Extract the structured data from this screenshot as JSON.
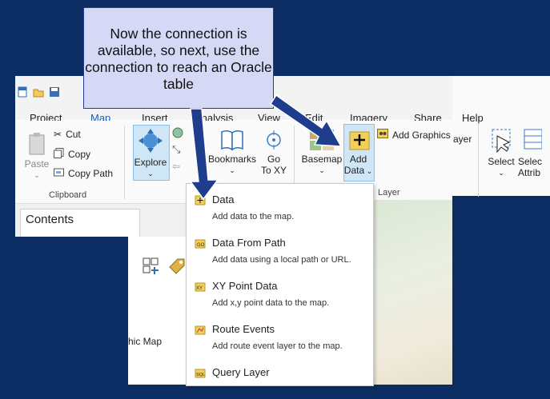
{
  "quick_access": [
    "new-project-icon",
    "open-project-icon",
    "save-project-icon"
  ],
  "tabs": [
    {
      "label": "Project"
    },
    {
      "label": "Map",
      "active": true
    },
    {
      "label": "Insert"
    },
    {
      "label": "Analysis"
    },
    {
      "label": "View"
    },
    {
      "label": "Edit"
    },
    {
      "label": "Imagery"
    },
    {
      "label": "Share"
    },
    {
      "label": "Help"
    }
  ],
  "clipboard": {
    "paste": "Paste",
    "cut": "Cut",
    "copy": "Copy",
    "copy_path": "Copy Path",
    "group": "Clipboard"
  },
  "navigate": {
    "explore": "Explore",
    "bookmarks": "Bookmarks",
    "goto_line1": "Go",
    "goto_line2": "To XY"
  },
  "layer": {
    "basemap": "Basemap",
    "add_data_line1": "Add",
    "add_data_line2": "Data",
    "add_graphics": "Add Graphics",
    "ayer_fragment": "ayer",
    "group": "Layer"
  },
  "selection": {
    "select": "Select",
    "select_by_attr_line1": "Selec",
    "select_by_attr_line2": "Attrib"
  },
  "contents_title": "Contents",
  "map_item_fragment": "hic Map",
  "menu_items": [
    {
      "title": "Data",
      "desc": "Add data to the map."
    },
    {
      "title": "Data From Path",
      "desc": "Add data using a local path or URL."
    },
    {
      "title": "XY Point Data",
      "desc": "Add x,y point data to the map."
    },
    {
      "title": "Route Events",
      "desc": "Add route event layer to the map."
    },
    {
      "title": "Query Layer",
      "desc": ""
    }
  ],
  "callout": "Now the connection is available, so next, use the connection to reach an Oracle table",
  "colors": {
    "background": "#0b2d63",
    "callout_fill": "#d5d9f6",
    "arrow": "#1e3d8c",
    "accent": "#1b5fb4"
  }
}
